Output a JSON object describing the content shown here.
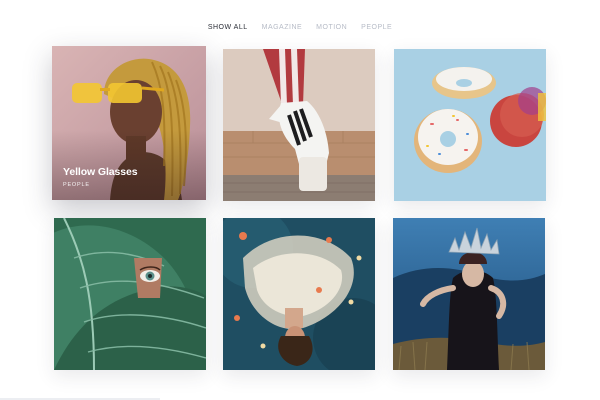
{
  "filters": [
    {
      "label": "SHOW ALL",
      "active": true
    },
    {
      "label": "MAGAZINE",
      "active": false
    },
    {
      "label": "MOTION",
      "active": false
    },
    {
      "label": "PEOPLE",
      "active": false
    }
  ],
  "tiles": [
    {
      "subject": "woman-yellow-glasses",
      "title": "Yellow Glasses",
      "category": "PEOPLE"
    },
    {
      "subject": "sneaker-on-tiptoe"
    },
    {
      "subject": "floating-donuts"
    },
    {
      "subject": "eye-behind-leaf"
    },
    {
      "subject": "woman-floating-in-water"
    },
    {
      "subject": "woman-with-crown"
    }
  ],
  "colors": {
    "filter_active": "#2a2d36",
    "filter_inactive": "#b7bcc7",
    "background": "#ffffff"
  }
}
